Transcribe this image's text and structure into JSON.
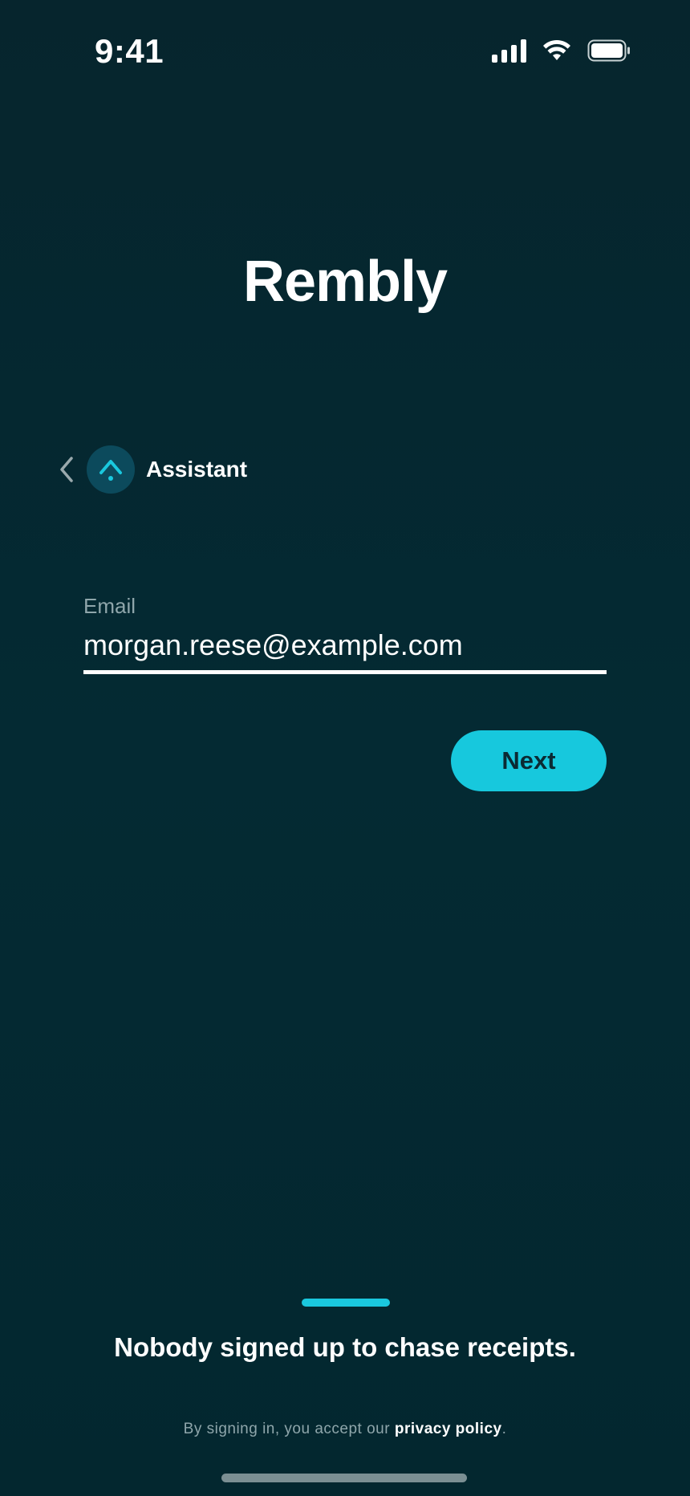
{
  "status_bar": {
    "time": "9:41",
    "icons": [
      "signal-icon",
      "wifi-icon",
      "battery-icon"
    ]
  },
  "app": {
    "title": "Rembly"
  },
  "assistant": {
    "name": "Assistant",
    "back_icon": "chevron-left-icon",
    "avatar_icon": "assistant-logo-icon"
  },
  "email_field": {
    "label": "Email",
    "value": "morgan.reese@example.com"
  },
  "next_button": {
    "label": "Next"
  },
  "footer": {
    "tagline": "Nobody signed up to chase receipts.",
    "legal_prefix": "By signing in, you accept our ",
    "legal_link": "privacy policy",
    "legal_suffix": "."
  },
  "colors": {
    "background": "#052a33",
    "accent": "#17c8dd",
    "muted_text": "#8fa6ab",
    "avatar_bg": "#0c4a5c"
  }
}
